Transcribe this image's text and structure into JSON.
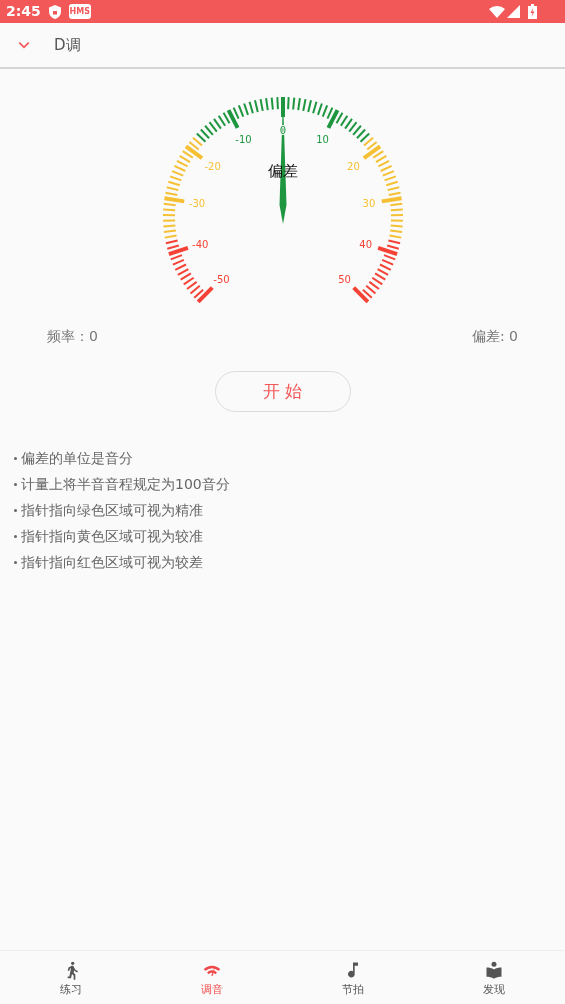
{
  "status_bar": {
    "time": "2:45",
    "badge": "HMS"
  },
  "header": {
    "title": "D调"
  },
  "gauge": {
    "caption": "偏差",
    "level": 0.5,
    "tick_labels": [
      {
        "text": "-50",
        "color": "#f44336"
      },
      {
        "text": "-40",
        "color": "#f44336"
      },
      {
        "text": "-30",
        "color": "#f5c033"
      },
      {
        "text": "-20",
        "color": "#f5c033"
      },
      {
        "text": "-10",
        "color": "#1e9640"
      },
      {
        "text": "0",
        "color": "#1e9640"
      },
      {
        "text": "10",
        "color": "#1e9640"
      },
      {
        "text": "20",
        "color": "#f5c033"
      },
      {
        "text": "30",
        "color": "#f5c033"
      },
      {
        "text": "40",
        "color": "#f44336"
      },
      {
        "text": "50",
        "color": "#f44336"
      }
    ]
  },
  "readings": {
    "frequency": "频率：0",
    "deviation": "偏差: 0"
  },
  "start_button": "开 始",
  "notes": [
    "偏差的单位是音分",
    "计量上将半音音程规定为100音分",
    "指针指向绿色区域可视为精准",
    "指针指向黄色区域可视为较准",
    "指针指向红色区域可视为较差"
  ],
  "bottom_nav": [
    {
      "label": "练习",
      "kind": "run",
      "selected": false
    },
    {
      "label": "调音",
      "kind": "tuner",
      "selected": true
    },
    {
      "label": "节拍",
      "kind": "note",
      "selected": false
    },
    {
      "label": "发现",
      "kind": "book",
      "selected": false
    }
  ]
}
